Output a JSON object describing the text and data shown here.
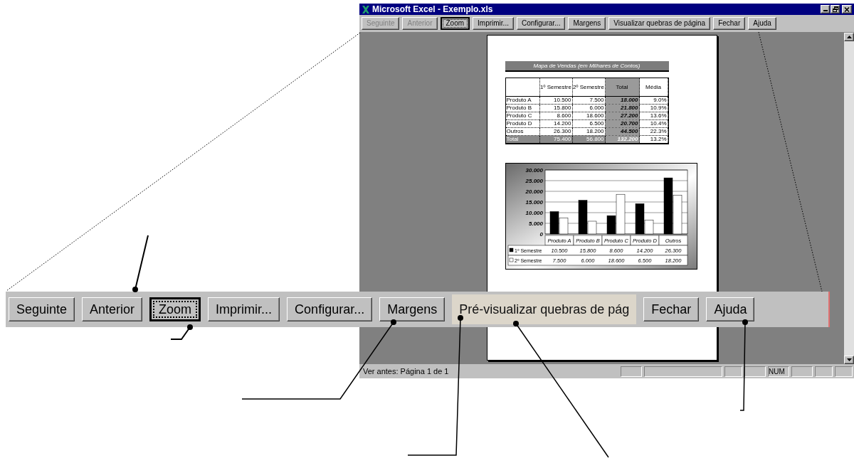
{
  "window": {
    "title": "Microsoft Excel - Exemplo.xls"
  },
  "toolbar": [
    {
      "label": "Seguinte",
      "disabled": true,
      "focused": false
    },
    {
      "label": "Anterior",
      "disabled": true,
      "focused": false
    },
    {
      "label": "Zoom",
      "disabled": false,
      "focused": true
    },
    {
      "label": "Imprimir...",
      "disabled": false,
      "focused": false
    },
    {
      "label": "Configurar...",
      "disabled": false,
      "focused": false
    },
    {
      "label": "Margens",
      "disabled": false,
      "focused": false
    },
    {
      "label": "Visualizar quebras de página",
      "disabled": false,
      "focused": false
    },
    {
      "label": "Fechar",
      "disabled": false,
      "focused": false
    },
    {
      "label": "Ajuda",
      "disabled": false,
      "focused": false
    }
  ],
  "preview_page": {
    "title": "Mapa de Vendas (em Milhares de Contos)",
    "table": {
      "columns": [
        "",
        "1º Semestre",
        "2º Semestre",
        "Total",
        "Média"
      ],
      "rows": [
        [
          "Produto A",
          "10.500",
          "7.500",
          "18.000",
          "9.0%"
        ],
        [
          "Produto B",
          "15.800",
          "6.000",
          "21.800",
          "10.9%"
        ],
        [
          "Produto C",
          "8.600",
          "18.600",
          "27.200",
          "13.6%"
        ],
        [
          "Produto D",
          "14.200",
          "6.500",
          "20.700",
          "10.4%"
        ],
        [
          "Outros",
          "26.300",
          "18.200",
          "44.500",
          "22.3%"
        ],
        [
          "Total",
          "75.400",
          "56.800",
          "132.200",
          "13.2%"
        ]
      ]
    },
    "chart_data": {
      "type": "bar",
      "categories": [
        "Produto A",
        "Produto B",
        "Produto C",
        "Produto D",
        "Outros"
      ],
      "series": [
        {
          "name": "1º Semestre",
          "color": "#000000",
          "values": [
            10.5,
            15.8,
            8.6,
            14.2,
            26.3
          ],
          "value_labels": [
            "10.500",
            "15.800",
            "8.600",
            "14.200",
            "26.300"
          ]
        },
        {
          "name": "2º Semestre",
          "color": "#ffffff",
          "values": [
            7.5,
            6.0,
            18.6,
            6.5,
            18.2
          ],
          "value_labels": [
            "7.500",
            "6.000",
            "18.600",
            "6.500",
            "18.200"
          ]
        }
      ],
      "grid": true,
      "legend": "left",
      "ylim": [
        0,
        30
      ],
      "yticks": [
        {
          "value": 0,
          "label": "0"
        },
        {
          "value": 5,
          "label": "5.000"
        },
        {
          "value": 10,
          "label": "10.000"
        },
        {
          "value": 15,
          "label": "15.000"
        },
        {
          "value": 20,
          "label": "20.000"
        },
        {
          "value": 25,
          "label": "25.000"
        },
        {
          "value": 30,
          "label": "30.000"
        }
      ]
    }
  },
  "status_bar": {
    "text": "Ver antes: Página 1 de 1",
    "indicator": "NUM"
  },
  "zoomed_toolbar": [
    {
      "label": "Seguinte",
      "focused": false,
      "highlighted": false
    },
    {
      "label": "Anterior",
      "focused": false,
      "highlighted": false
    },
    {
      "label": "Zoom",
      "focused": true,
      "highlighted": false
    },
    {
      "label": "Imprimir...",
      "focused": false,
      "highlighted": false
    },
    {
      "label": "Configurar...",
      "focused": false,
      "highlighted": false
    },
    {
      "label": "Margens",
      "focused": false,
      "highlighted": false
    },
    {
      "label": "Pré-visualizar quebras de pág",
      "focused": false,
      "highlighted": true
    },
    {
      "label": "Fechar",
      "focused": false,
      "highlighted": false
    },
    {
      "label": "Ajuda",
      "focused": false,
      "highlighted": false
    }
  ]
}
